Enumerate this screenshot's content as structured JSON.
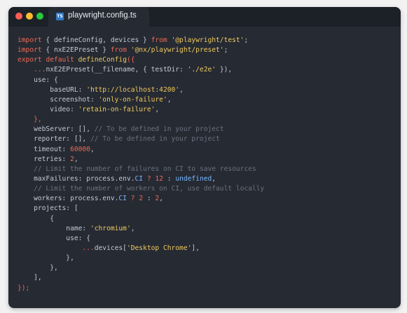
{
  "window": {
    "tab_title": "playwright.config.ts",
    "tab_icon": "TS",
    "colors": {
      "background": "#252a33",
      "titlebar": "#1c2027",
      "keyword": "#ef6a54",
      "string": "#f0c95e",
      "comment": "#6a737f",
      "text": "#c3cad4",
      "ts_icon": "#3178c6"
    }
  },
  "code": {
    "lines": [
      [
        [
          "kw",
          "import"
        ],
        [
          "id",
          " { defineConfig, devices } "
        ],
        [
          "kw",
          "from"
        ],
        [
          "id",
          " "
        ],
        [
          "str",
          "'@playwright/test'"
        ],
        [
          "id",
          ";"
        ]
      ],
      [
        [
          "kw",
          "import"
        ],
        [
          "id",
          " { nxE2EPreset } "
        ],
        [
          "kw",
          "from"
        ],
        [
          "id",
          " "
        ],
        [
          "str",
          "'@nx/playwright/preset'"
        ],
        [
          "id",
          ";"
        ]
      ],
      [
        [
          "kw",
          "export"
        ],
        [
          "id",
          " "
        ],
        [
          "kw",
          "default"
        ],
        [
          "id",
          " "
        ],
        [
          "fn",
          "defineConfig"
        ],
        [
          "pun",
          "({"
        ]
      ],
      [
        [
          "id",
          "    "
        ],
        [
          "pun",
          "..."
        ],
        [
          "id",
          "nxE2EPreset(__filename, { testDir: "
        ],
        [
          "str",
          "'./e2e'"
        ],
        [
          "id",
          " }),"
        ]
      ],
      [
        [
          "id",
          "    use: {"
        ]
      ],
      [
        [
          "id",
          "        baseURL: "
        ],
        [
          "str",
          "'http://localhost:4200'"
        ],
        [
          "id",
          ","
        ]
      ],
      [
        [
          "id",
          "        screenshot: "
        ],
        [
          "str",
          "'only-on-failure'"
        ],
        [
          "id",
          ","
        ]
      ],
      [
        [
          "id",
          "        video: "
        ],
        [
          "str",
          "'retain-on-failure'"
        ],
        [
          "id",
          ","
        ]
      ],
      [
        [
          "id",
          "    "
        ],
        [
          "pun",
          "},"
        ]
      ],
      [
        [
          "id",
          "    webServer: [], "
        ],
        [
          "cmt",
          "// To be defined in your project"
        ]
      ],
      [
        [
          "id",
          "    reporter: [], "
        ],
        [
          "cmt",
          "// To be defined in your project"
        ]
      ],
      [
        [
          "id",
          "    timeout: "
        ],
        [
          "num",
          "60000"
        ],
        [
          "id",
          ","
        ]
      ],
      [
        [
          "id",
          "    retries: "
        ],
        [
          "num",
          "2"
        ],
        [
          "id",
          ","
        ]
      ],
      [
        [
          "cmt",
          "    // Limit the number of failures on CI to save resources"
        ]
      ],
      [
        [
          "id",
          "    maxFailures: process.env."
        ],
        [
          "cst",
          "CI"
        ],
        [
          "id",
          " "
        ],
        [
          "pun",
          "?"
        ],
        [
          "id",
          " "
        ],
        [
          "num",
          "12"
        ],
        [
          "id",
          " : "
        ],
        [
          "cst",
          "undefined"
        ],
        [
          "id",
          ","
        ]
      ],
      [
        [
          "cmt",
          "    // Limit the number of workers on CI, use default locally"
        ]
      ],
      [
        [
          "id",
          "    workers: process.env."
        ],
        [
          "cst",
          "CI"
        ],
        [
          "id",
          " "
        ],
        [
          "pun",
          "?"
        ],
        [
          "id",
          " "
        ],
        [
          "num",
          "2"
        ],
        [
          "id",
          " : "
        ],
        [
          "num",
          "2"
        ],
        [
          "id",
          ","
        ]
      ],
      [
        [
          "id",
          "    projects: ["
        ]
      ],
      [
        [
          "id",
          "        {"
        ]
      ],
      [
        [
          "id",
          "            name: "
        ],
        [
          "str",
          "'chromium'"
        ],
        [
          "id",
          ","
        ]
      ],
      [
        [
          "id",
          "            use: {"
        ]
      ],
      [
        [
          "id",
          "                "
        ],
        [
          "pun",
          "..."
        ],
        [
          "id",
          "devices["
        ],
        [
          "str",
          "'Desktop Chrome'"
        ],
        [
          "id",
          "],"
        ]
      ],
      [
        [
          "id",
          "            },"
        ]
      ],
      [
        [
          "id",
          "        },"
        ]
      ],
      [
        [
          "id",
          "    ],"
        ]
      ],
      [
        [
          "pun",
          "});"
        ]
      ]
    ]
  }
}
